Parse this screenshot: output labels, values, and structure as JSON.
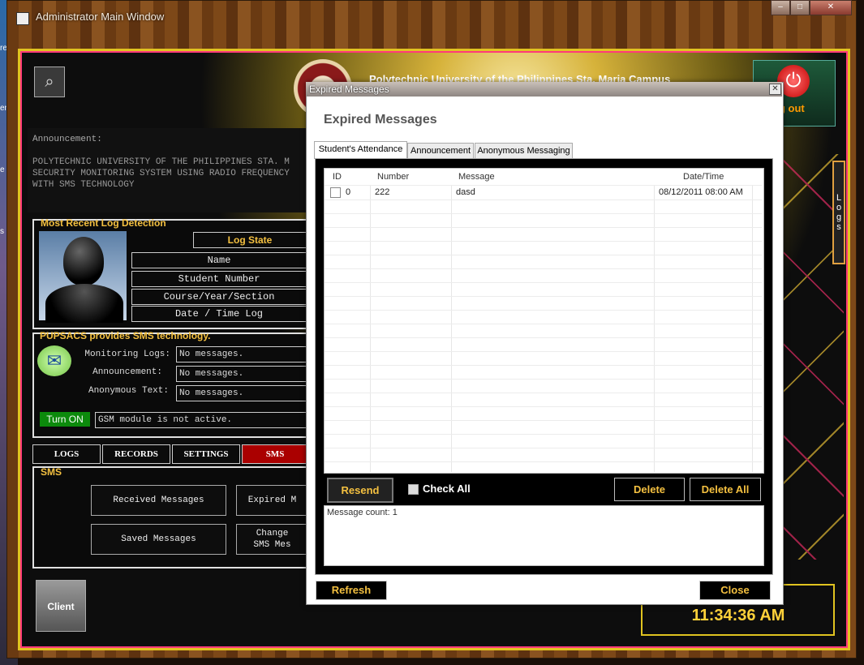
{
  "desktop": {
    "labels": [
      "reen",
      "em",
      "e Ein",
      "s"
    ]
  },
  "window": {
    "title": "Administrator Main Window",
    "caption_min": "–",
    "caption_max": "□",
    "caption_close": "✕"
  },
  "header": {
    "university": "Polytechnic University of the Philippines Sta. Maria Campus",
    "logout_glyph": "⏻",
    "logout_label": "g out"
  },
  "announcement": {
    "title": "Announcement:",
    "body": "POLYTECHNIC UNIVERSITY OF THE PHILIPPINES STA. M SECURITY MONITORING SYSTEM USING RADIO FREQUENCY WITH SMS TECHNOLOGY"
  },
  "recent_log": {
    "title": "Most Recent Log Detection",
    "log_state": "Log State",
    "name": "Name",
    "student_number": "Student Number",
    "course": "Course/Year/Section",
    "datetime": "Date / Time Log"
  },
  "sms_info": {
    "title": "PUPSACS provides SMS technology.",
    "monitoring_label": "Monitoring Logs:",
    "monitoring_value": "No messages.",
    "announcement_label": "Announcement:",
    "announcement_value": "No messages.",
    "anonymous_label": "Anonymous Text:",
    "anonymous_value": "No messages.",
    "turn_on": "Turn ON",
    "gsm_status": "GSM module is not active."
  },
  "nav_tabs": {
    "logs": "LOGS",
    "records": "RECORDS",
    "settings": "SETTINGS",
    "sms": "SMS"
  },
  "sms_section": {
    "title": "SMS",
    "received": "Received Messages",
    "expired": "Expired M",
    "saved": "Saved Messages",
    "change": "Change\nSMS Mes"
  },
  "footer": {
    "client": "Client",
    "logs_side": "L o g s",
    "clock": "11:34:36 AM"
  },
  "dialog": {
    "title": "Expired Messages",
    "header": "Expired Messages",
    "close_glyph": "✕",
    "tabs": [
      "Student's Attendance",
      "Announcement",
      "Anonymous Messaging"
    ],
    "columns": [
      "ID",
      "Number",
      "Message",
      "Date/Time"
    ],
    "rows": [
      {
        "id": "0",
        "number": "222",
        "message": "dasd",
        "datetime": "08/12/2011 08:00 AM"
      }
    ],
    "resend": "Resend",
    "check_all": "Check All",
    "delete": "Delete",
    "delete_all": "Delete All",
    "message_count": "Message count: 1",
    "refresh": "Refresh",
    "close": "Close"
  }
}
